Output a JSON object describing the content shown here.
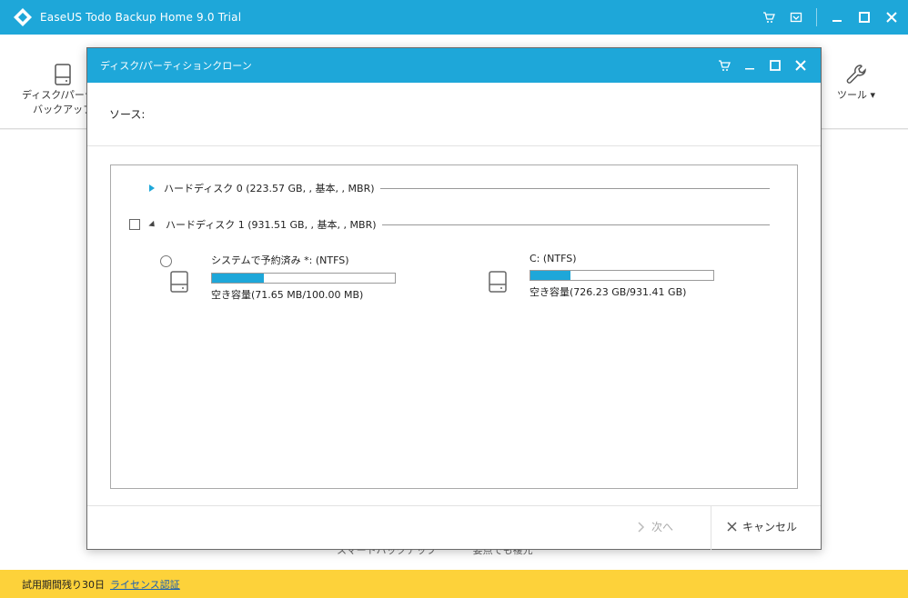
{
  "app": {
    "title": "EaseUS Todo Backup Home 9.0 Trial"
  },
  "toolbar": {
    "disk_backup_label_line1": "ディスク/パーティ",
    "disk_backup_label_line2": "バックアップ",
    "tools_label": "ツール ▾"
  },
  "background_links": {
    "link1": "スマートバックアップ",
    "link2": "要点でも複元"
  },
  "statusbar": {
    "trial_text": "試用期間残り30日",
    "license_link": "ライセンス認証"
  },
  "dialog": {
    "title": "ディスク/パーティションクローン",
    "source_label": "ソース:",
    "disks": [
      {
        "label": "ハードディスク 0 (223.57 GB, , 基本, , MBR)",
        "expanded": false
      },
      {
        "label": "ハードディスク 1 (931.51 GB, , 基本, , MBR)",
        "expanded": true
      }
    ],
    "partitions": [
      {
        "name": "システムで予約済み *: (NTFS)",
        "free": "空き容量(71.65 MB/100.00 MB)",
        "used_fraction": 0.284
      },
      {
        "name": "C: (NTFS)",
        "free": "空き容量(726.23 GB/931.41 GB)",
        "used_fraction": 0.22
      }
    ],
    "next_label": "次へ",
    "cancel_label": "キャンセル"
  },
  "colors": {
    "accent": "#1ea7d9",
    "statusbar": "#fdd23a"
  }
}
